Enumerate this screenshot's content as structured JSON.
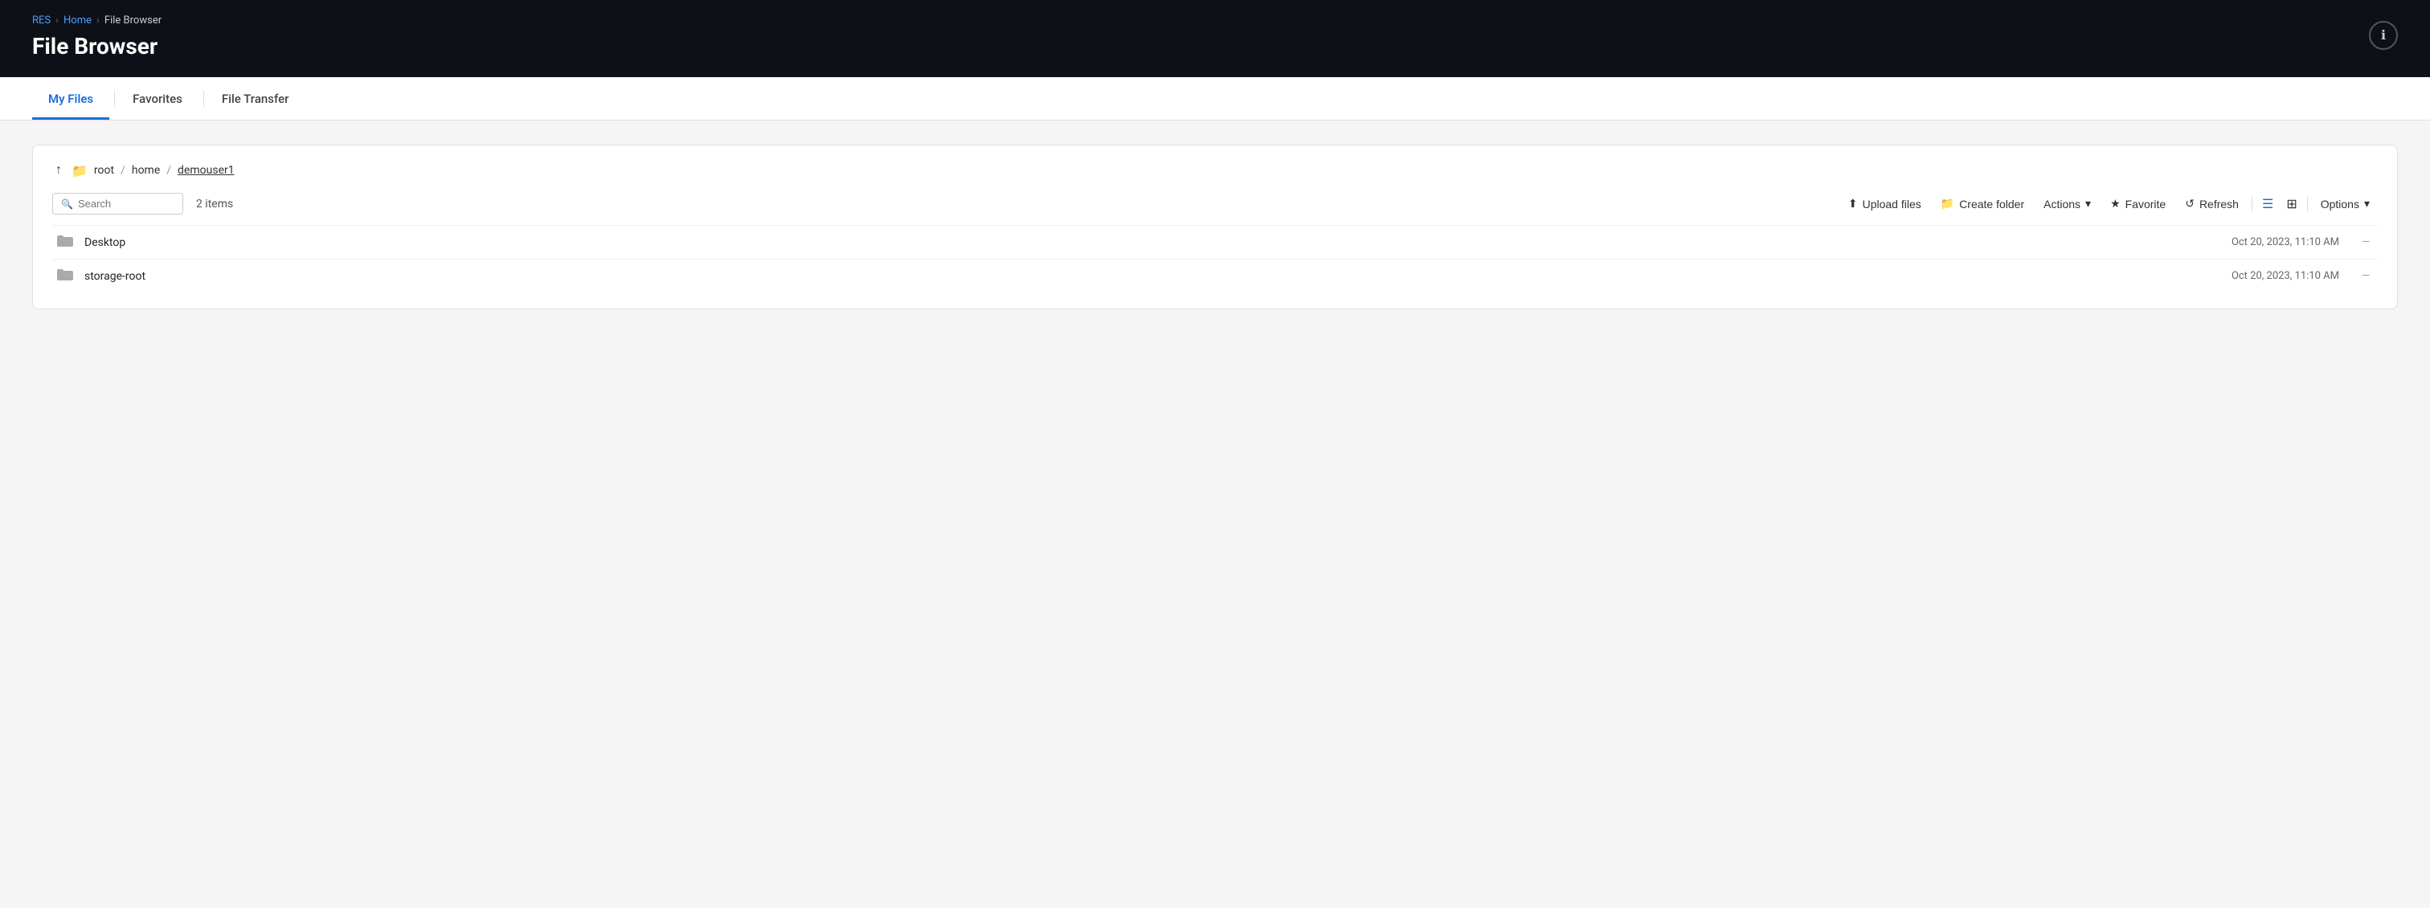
{
  "header": {
    "breadcrumb": [
      {
        "label": "RES",
        "type": "link"
      },
      {
        "label": "Home",
        "type": "link"
      },
      {
        "label": "File Browser",
        "type": "current"
      }
    ],
    "title": "File Browser",
    "user_icon": "ℹ"
  },
  "tabs": [
    {
      "label": "My Files",
      "active": true
    },
    {
      "label": "Favorites",
      "active": false
    },
    {
      "label": "File Transfer",
      "active": false
    }
  ],
  "file_browser": {
    "path": {
      "up_arrow": "↑",
      "segments": [
        "root",
        "home",
        "demouser1"
      ],
      "separators": [
        "/",
        "/"
      ]
    },
    "toolbar": {
      "search_placeholder": "Search",
      "item_count": "2 items",
      "upload_label": "Upload files",
      "create_folder_label": "Create folder",
      "actions_label": "Actions",
      "favorite_label": "Favorite",
      "refresh_label": "Refresh",
      "options_label": "Options"
    },
    "files": [
      {
        "name": "Desktop",
        "type": "folder",
        "date": "Oct 20, 2023, 11:10 AM",
        "size": "—"
      },
      {
        "name": "storage-root",
        "type": "folder",
        "date": "Oct 20, 2023, 11:10 AM",
        "size": "—"
      }
    ]
  }
}
